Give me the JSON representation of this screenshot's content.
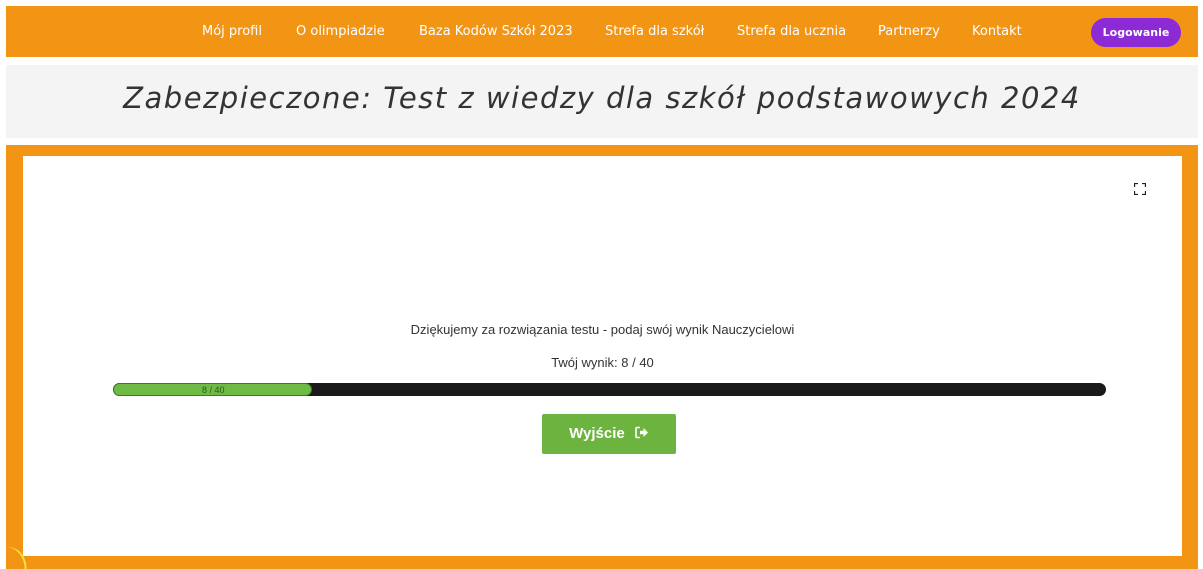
{
  "nav": {
    "items": [
      {
        "label": "Mój profil"
      },
      {
        "label": "O olimpiadzie"
      },
      {
        "label": "Baza Kodów Szkół 2023"
      },
      {
        "label": "Strefa dla szkół"
      },
      {
        "label": "Strefa dla ucznia"
      },
      {
        "label": "Partnerzy"
      },
      {
        "label": "Kontakt"
      }
    ],
    "login_label": "Logowanie"
  },
  "header": {
    "title": "Zabezpieczone: Test z wiedzy dla szkół podstawowych 2024"
  },
  "result": {
    "thanks_message": "Dziękujemy za rozwiązania testu - podaj swój wynik Nauczycielowi",
    "score_text": "Twój wynik: 8 / 40",
    "progress_label": "8 / 40",
    "score": 8,
    "max_score": 40
  },
  "actions": {
    "exit_label": "Wyjście",
    "exit_icon": "sign-out-icon",
    "fullscreen_icon": "fullscreen-icon"
  },
  "colors": {
    "nav_bg": "#f39514",
    "login_bg": "#8c2ad6",
    "progress_fill": "#6dbb45",
    "progress_track": "#1a1a1a",
    "exit_bg": "#6db33f"
  }
}
